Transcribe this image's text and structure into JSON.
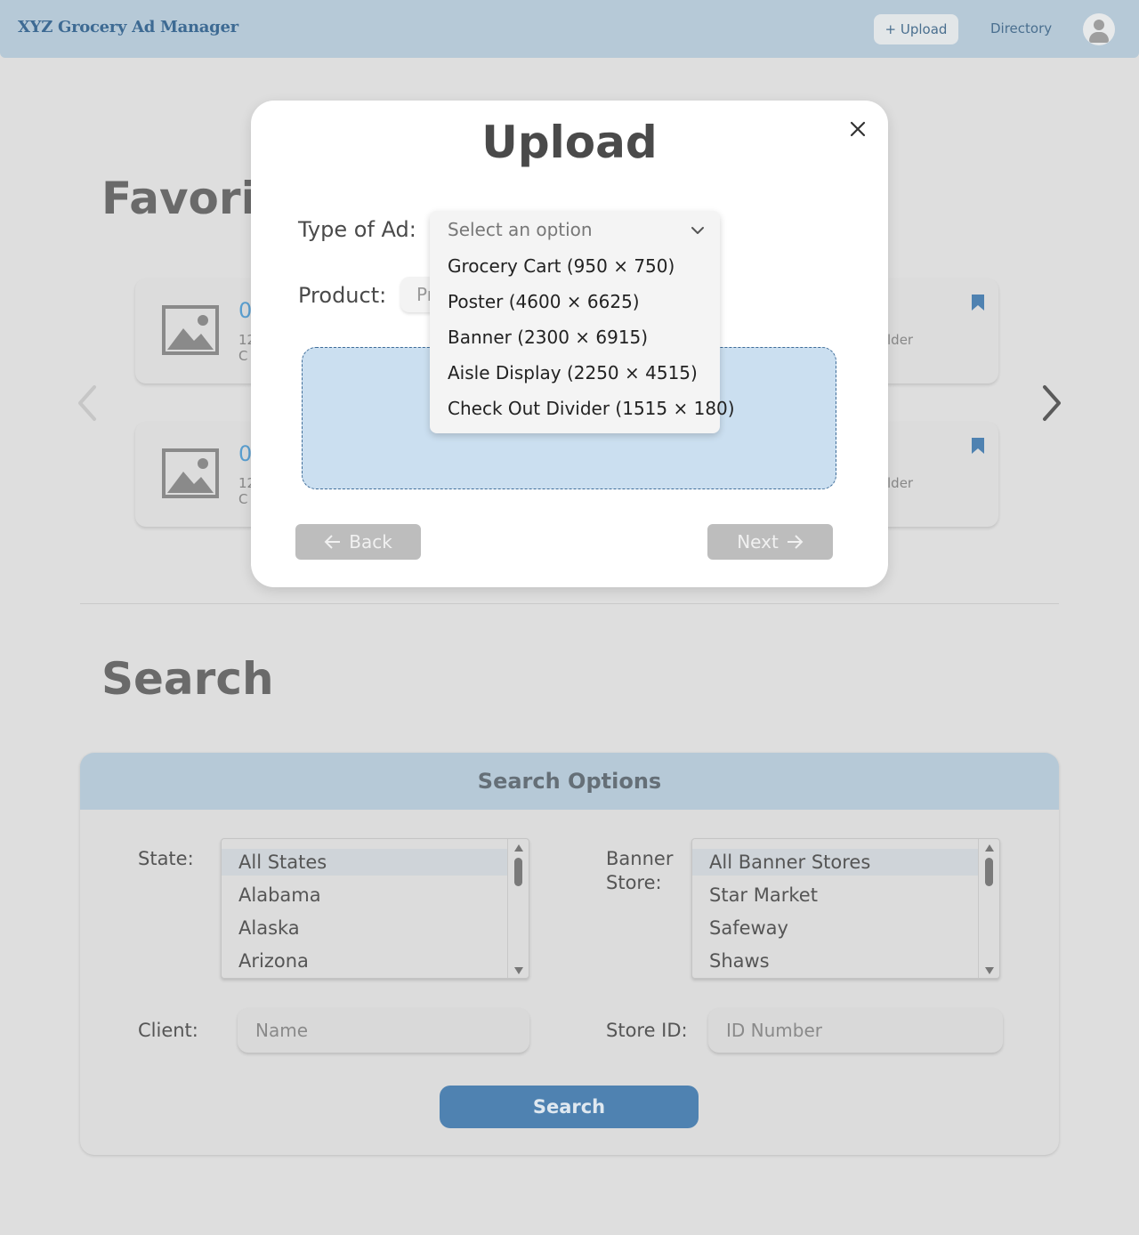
{
  "header": {
    "brand": "XYZ Grocery Ad Manager",
    "upload_label": "+ Upload",
    "directory_label": "Directory"
  },
  "favorites": {
    "title": "Favorit",
    "cards": [
      {
        "number": "0",
        "line1": "12",
        "line2": "C",
        "right_text": "lder"
      },
      {
        "number": "0",
        "line1": "12",
        "line2": "C",
        "right_text": "lder"
      }
    ]
  },
  "search": {
    "title": "Search",
    "panel_title": "Search Options",
    "state_label": "State:",
    "states": [
      "All States",
      "Alabama",
      "Alaska",
      "Arizona"
    ],
    "banner_label_line1": "Banner",
    "banner_label_line2": "Store:",
    "banner_stores": [
      "All Banner Stores",
      "Star Market",
      "Safeway",
      "Shaws"
    ],
    "client_label": "Client:",
    "client_placeholder": "Name",
    "store_id_label": "Store ID:",
    "store_id_placeholder": "ID Number",
    "search_button": "Search"
  },
  "modal": {
    "title": "Upload",
    "type_label": "Type of Ad:",
    "product_label": "Product:",
    "product_value": "Pr",
    "back_label": "Back",
    "next_label": "Next",
    "dropdown": {
      "placeholder": "Select an option",
      "options": [
        "Grocery Cart (950 × 750)",
        "Poster (4600 × 6625)",
        "Banner (2300 × 6915)",
        "Aisle Display (2250 × 4515)",
        "Check Out Divider (1515 × 180)"
      ]
    }
  },
  "colors": {
    "header_bg": "#b6c9d7",
    "accent_blue": "#4f82b1",
    "dropzone_bg": "#cbdff0",
    "page_bg": "#dedede"
  }
}
